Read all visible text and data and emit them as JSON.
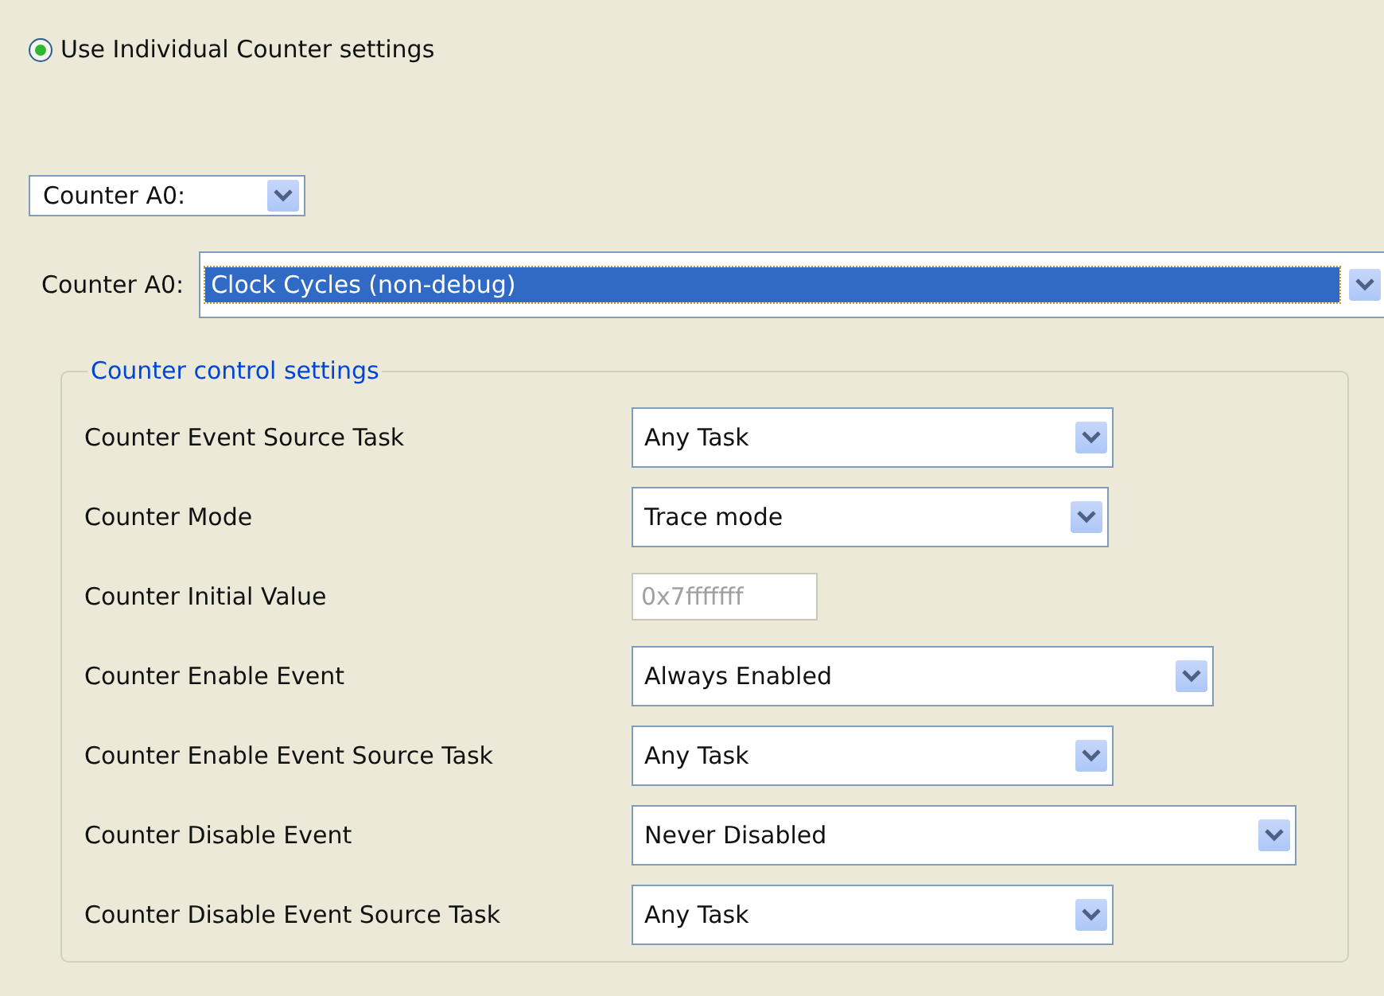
{
  "radio": {
    "label": "Use Individual Counter settings",
    "selected": true
  },
  "counter_picker": {
    "value": "Counter A0:"
  },
  "counter_event": {
    "label": "Counter A0:",
    "value": "Clock Cycles (non-debug)",
    "highlighted": true
  },
  "group": {
    "title": "Counter control settings",
    "rows": [
      {
        "label": "Counter Event Source Task",
        "kind": "dropdown",
        "value": "Any Task"
      },
      {
        "label": "Counter Mode",
        "kind": "dropdown",
        "value": "Trace mode"
      },
      {
        "label": "Counter Initial Value",
        "kind": "text",
        "value": "0x7fffffff",
        "disabled": true
      },
      {
        "label": "Counter Enable Event",
        "kind": "dropdown",
        "value": "Always Enabled"
      },
      {
        "label": "Counter Enable Event Source Task",
        "kind": "dropdown",
        "value": "Any Task"
      },
      {
        "label": "Counter Disable Event",
        "kind": "dropdown",
        "value": "Never Disabled"
      },
      {
        "label": "Counter Disable Event Source Task",
        "kind": "dropdown",
        "value": "Any Task"
      }
    ]
  }
}
